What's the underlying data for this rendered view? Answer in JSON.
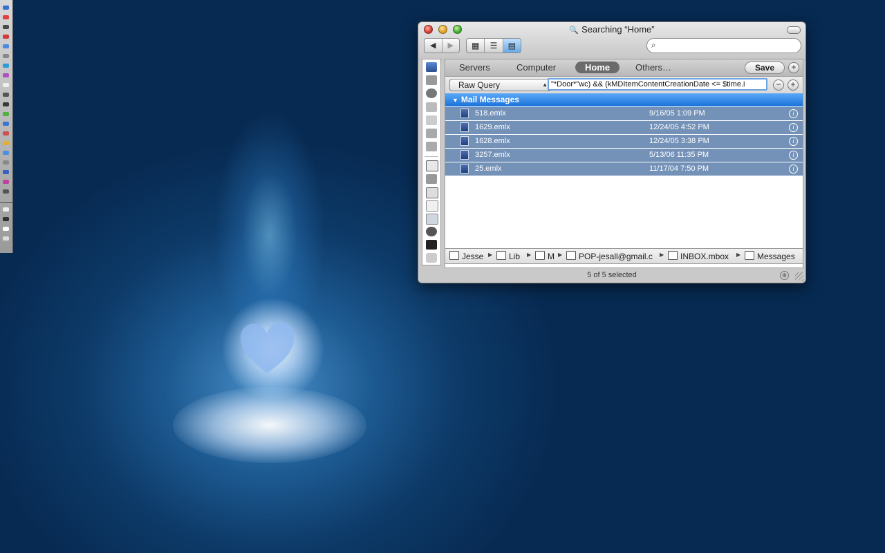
{
  "window": {
    "title": "Searching “Home”",
    "title_icon": "magnifier-icon",
    "nav": {
      "back": "◀",
      "forward": "▶"
    },
    "view_buttons": [
      "▦",
      "☰",
      "▤"
    ],
    "search_placeholder": "",
    "search_value": ""
  },
  "scope_bar": {
    "items": [
      "Servers",
      "Computer",
      "Home",
      "Others…"
    ],
    "selected": "Home",
    "save_label": "Save",
    "add_label": "+"
  },
  "query_bar": {
    "criteria": "Raw Query",
    "query": "\"*Door*\"wc) && (kMDItemContentCreationDate <= $time.i",
    "remove_label": "−",
    "add_label": "+"
  },
  "results": {
    "group_label": "Mail Messages",
    "rows": [
      {
        "name": "518.emlx",
        "date": "9/16/05 1:09 PM",
        "info": "i"
      },
      {
        "name": "1629.emlx",
        "date": "12/24/05 4:52 PM",
        "info": "i"
      },
      {
        "name": "1628.emlx",
        "date": "12/24/05 3:38 PM",
        "info": "i"
      },
      {
        "name": "3257.emlx",
        "date": "5/13/06 11:35 PM",
        "info": "i"
      },
      {
        "name": "25.emlx",
        "date": "11/17/04 7:50 PM",
        "info": "i"
      }
    ]
  },
  "path_bar": {
    "crumbs": [
      "Jesse",
      "Lib",
      "M",
      "POP-jesall@gmail.c",
      "INBOX.mbox",
      "Messages"
    ]
  },
  "status": "5 of 5 selected",
  "colors": {
    "selection": "#7492b8",
    "group_header": "#1a72d8",
    "desktop": "#0d3a68"
  }
}
